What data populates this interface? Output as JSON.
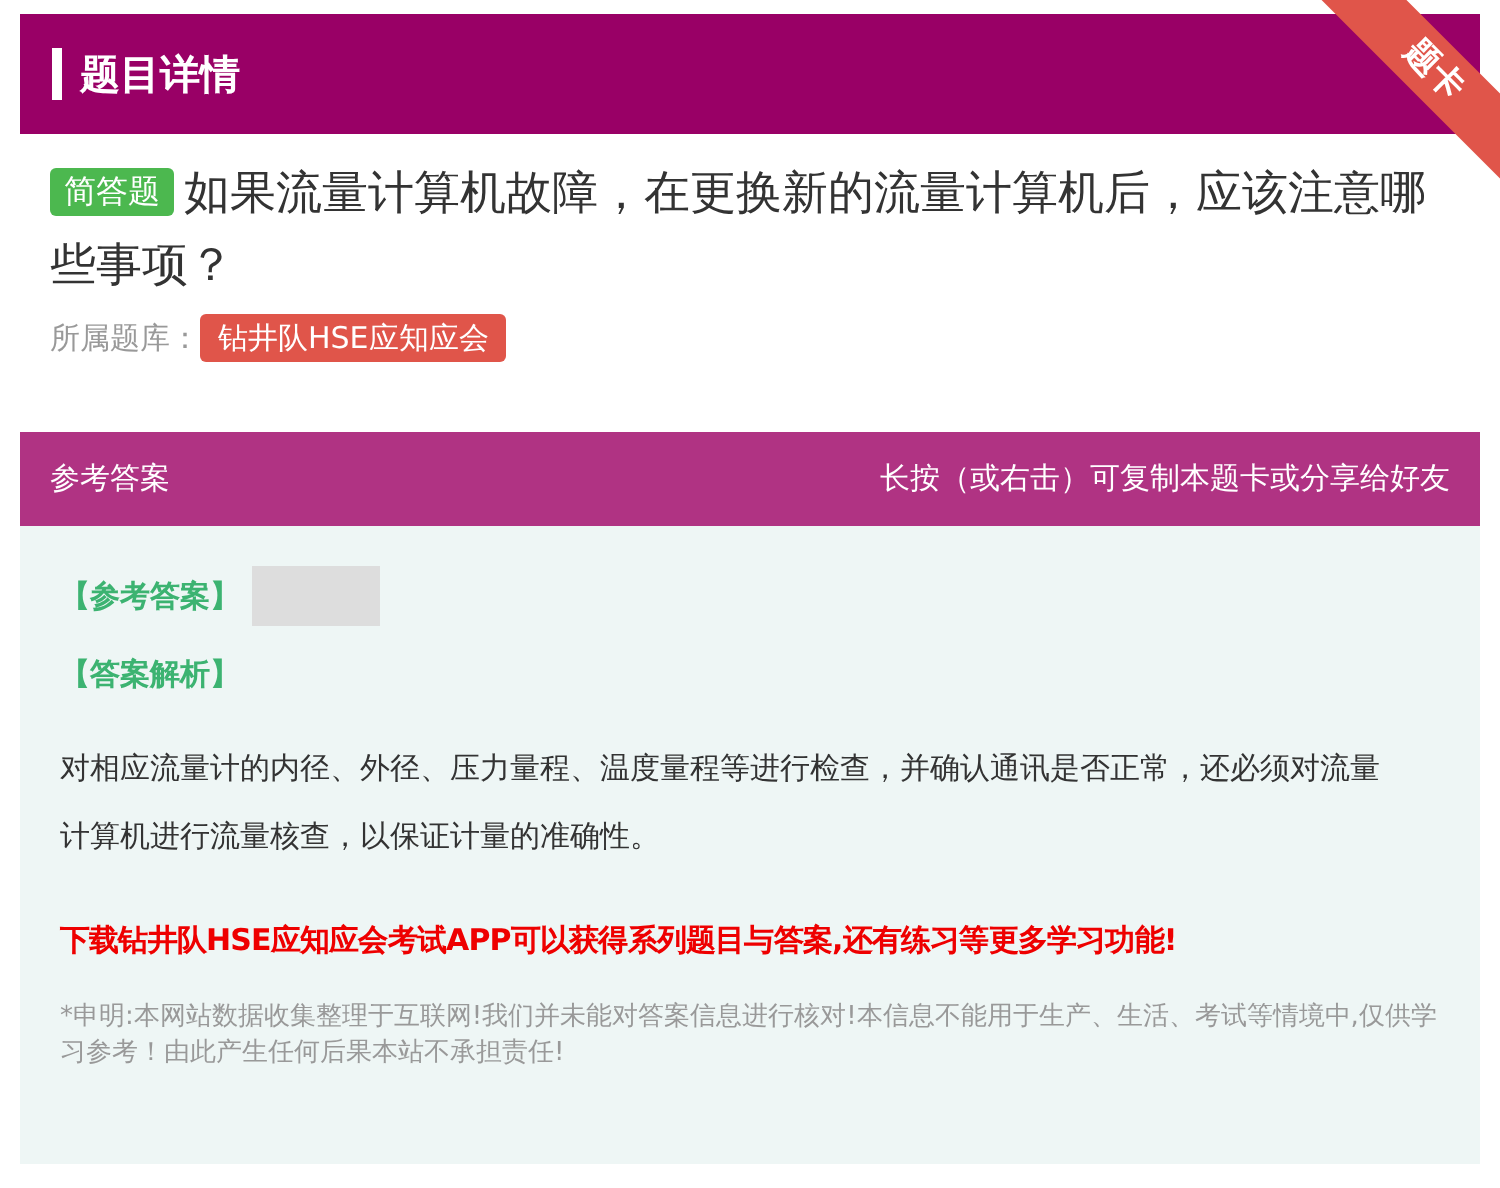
{
  "header": {
    "title": "题目详情",
    "ribbon": "题卡"
  },
  "question": {
    "type_badge": "简答题",
    "text": "如果流量计算机故障，在更换新的流量计算机后，应该注意哪些事项？",
    "source_label": "所属题库：",
    "source_tag": "钻井队HSE应知应会"
  },
  "answer": {
    "title": "参考答案",
    "hint": "长按（或右击）可复制本题卡或分享给好友",
    "answer_label": "【参考答案】",
    "analysis_label": "【答案解析】",
    "analysis": "对相应流量计的内径、外径、压力量程、温度量程等进行检查，并确认通讯是否正常，还必须对流量计算机进行流量核查，以保证计量的准确性。",
    "promo": "下载钻井队HSE应知应会考试APP可以获得系列题目与答案,还有练习等更多学习功能!",
    "disclaimer": "*申明:本网站数据收集整理于互联网!我们并未能对答案信息进行核对!本信息不能用于生产、生活、考试等情境中,仅供学习参考！由此产生任何后果本站不承担责任!"
  }
}
